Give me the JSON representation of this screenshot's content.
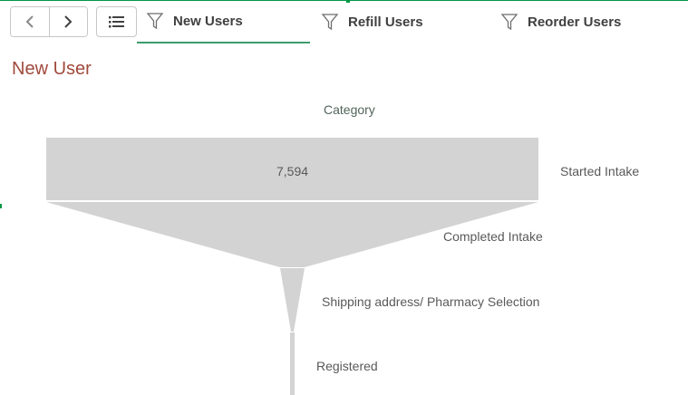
{
  "toolbar": {
    "back_icon": "chevron-left-icon",
    "forward_icon": "chevron-right-icon",
    "list_icon": "list-icon"
  },
  "tabs": [
    {
      "label": "New Users",
      "icon": "filter-icon",
      "active": true
    },
    {
      "label": "Refill Users",
      "icon": "filter-icon",
      "active": false
    },
    {
      "label": "Reorder Users",
      "icon": "filter-icon",
      "active": false
    }
  ],
  "sheet": {
    "title": "New User"
  },
  "colors": {
    "accent": "#009845",
    "tab_underline": "#3f9b6e",
    "title": "#a04a3c",
    "funnel_fill": "#d3d3d3"
  },
  "chart_data": {
    "type": "funnel",
    "dimension_label": "Category",
    "stages": [
      {
        "label": "Started Intake",
        "value_label": "7,594"
      },
      {
        "label": "Completed Intake",
        "value_label": ""
      },
      {
        "label": "Shipping address/ Pharmacy Selection",
        "value_label": ""
      },
      {
        "label": "Registered",
        "value_label": ""
      }
    ]
  }
}
